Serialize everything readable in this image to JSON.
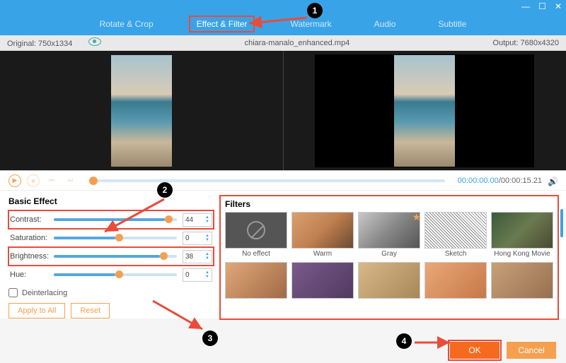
{
  "window": {
    "min": "—",
    "max": "☐",
    "close": "✕"
  },
  "tabs": {
    "rotate": "Rotate & Crop",
    "effect": "Effect & Filter",
    "watermark": "Watermark",
    "audio": "Audio",
    "subtitle": "Subtitle"
  },
  "info": {
    "original_label": "Original: 750x1334",
    "filename": "chiara-manalo_enhanced.mp4",
    "output_label": "Output: 7680x4320"
  },
  "time": {
    "current": "00:00:00.00",
    "sep": "/",
    "total": "00:00:15.21"
  },
  "basic": {
    "heading": "Basic Effect",
    "contrast_label": "Contrast:",
    "contrast_val": "44",
    "saturation_label": "Saturation:",
    "saturation_val": "0",
    "brightness_label": "Brightness:",
    "brightness_val": "38",
    "hue_label": "Hue:",
    "hue_val": "0",
    "deinterlace_label": "Deinterlacing",
    "apply": "Apply to All",
    "reset": "Reset"
  },
  "filters": {
    "heading": "Filters",
    "noeffect": "No effect",
    "warm": "Warm",
    "gray": "Gray",
    "sketch": "Sketch",
    "hk": "Hong Kong Movie"
  },
  "footer": {
    "ok": "OK",
    "cancel": "Cancel"
  },
  "callouts": {
    "c1": "1",
    "c2": "2",
    "c3": "3",
    "c4": "4"
  }
}
